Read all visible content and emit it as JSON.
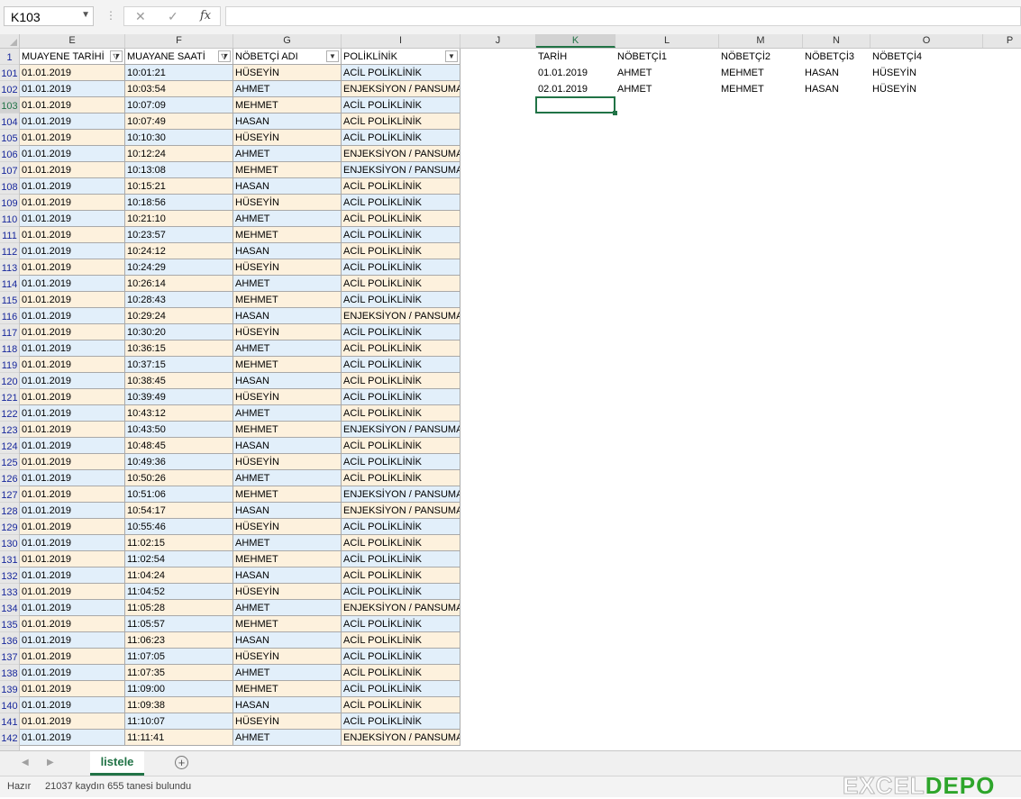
{
  "formula_bar": {
    "name_box": "K103",
    "cancel_icon": "✕",
    "enter_icon": "✓",
    "fx_label": "fx",
    "formula": ""
  },
  "columns": [
    "E",
    "F",
    "G",
    "I",
    "J",
    "K",
    "L",
    "M",
    "N",
    "O",
    "P"
  ],
  "selected_column": "K",
  "table": {
    "headers": [
      "MUAYENE TARİHİ",
      "MUAYANE SAATİ",
      "NÖBETÇİ ADI",
      "POLİKLİNİK"
    ],
    "header_row_number": "1",
    "filtered_columns": [
      0,
      1
    ],
    "rows": [
      {
        "n": "101",
        "date": "01.01.2019",
        "time": "10:01:21",
        "name": "HÜSEYİN",
        "clinic": "ACİL POLİKLİNİK"
      },
      {
        "n": "102",
        "date": "01.01.2019",
        "time": "10:03:54",
        "name": "AHMET",
        "clinic": "ENJEKSİYON / PANSUMAN"
      },
      {
        "n": "103",
        "date": "01.01.2019",
        "time": "10:07:09",
        "name": "MEHMET",
        "clinic": "ACİL POLİKLİNİK"
      },
      {
        "n": "104",
        "date": "01.01.2019",
        "time": "10:07:49",
        "name": "HASAN",
        "clinic": "ACİL POLİKLİNİK"
      },
      {
        "n": "105",
        "date": "01.01.2019",
        "time": "10:10:30",
        "name": "HÜSEYİN",
        "clinic": "ACİL POLİKLİNİK"
      },
      {
        "n": "106",
        "date": "01.01.2019",
        "time": "10:12:24",
        "name": "AHMET",
        "clinic": "ENJEKSİYON / PANSUMAN"
      },
      {
        "n": "107",
        "date": "01.01.2019",
        "time": "10:13:08",
        "name": "MEHMET",
        "clinic": "ENJEKSİYON / PANSUMAN"
      },
      {
        "n": "108",
        "date": "01.01.2019",
        "time": "10:15:21",
        "name": "HASAN",
        "clinic": "ACİL POLİKLİNİK"
      },
      {
        "n": "109",
        "date": "01.01.2019",
        "time": "10:18:56",
        "name": "HÜSEYİN",
        "clinic": "ACİL POLİKLİNİK"
      },
      {
        "n": "110",
        "date": "01.01.2019",
        "time": "10:21:10",
        "name": "AHMET",
        "clinic": "ACİL POLİKLİNİK"
      },
      {
        "n": "111",
        "date": "01.01.2019",
        "time": "10:23:57",
        "name": "MEHMET",
        "clinic": "ACİL POLİKLİNİK"
      },
      {
        "n": "112",
        "date": "01.01.2019",
        "time": "10:24:12",
        "name": "HASAN",
        "clinic": "ACİL POLİKLİNİK"
      },
      {
        "n": "113",
        "date": "01.01.2019",
        "time": "10:24:29",
        "name": "HÜSEYİN",
        "clinic": "ACİL POLİKLİNİK"
      },
      {
        "n": "114",
        "date": "01.01.2019",
        "time": "10:26:14",
        "name": "AHMET",
        "clinic": "ACİL POLİKLİNİK"
      },
      {
        "n": "115",
        "date": "01.01.2019",
        "time": "10:28:43",
        "name": "MEHMET",
        "clinic": "ACİL POLİKLİNİK"
      },
      {
        "n": "116",
        "date": "01.01.2019",
        "time": "10:29:24",
        "name": "HASAN",
        "clinic": "ENJEKSİYON / PANSUMAN"
      },
      {
        "n": "117",
        "date": "01.01.2019",
        "time": "10:30:20",
        "name": "HÜSEYİN",
        "clinic": "ACİL POLİKLİNİK"
      },
      {
        "n": "118",
        "date": "01.01.2019",
        "time": "10:36:15",
        "name": "AHMET",
        "clinic": "ACİL POLİKLİNİK"
      },
      {
        "n": "119",
        "date": "01.01.2019",
        "time": "10:37:15",
        "name": "MEHMET",
        "clinic": "ACİL POLİKLİNİK"
      },
      {
        "n": "120",
        "date": "01.01.2019",
        "time": "10:38:45",
        "name": "HASAN",
        "clinic": "ACİL POLİKLİNİK"
      },
      {
        "n": "121",
        "date": "01.01.2019",
        "time": "10:39:49",
        "name": "HÜSEYİN",
        "clinic": "ACİL POLİKLİNİK"
      },
      {
        "n": "122",
        "date": "01.01.2019",
        "time": "10:43:12",
        "name": "AHMET",
        "clinic": "ACİL POLİKLİNİK"
      },
      {
        "n": "123",
        "date": "01.01.2019",
        "time": "10:43:50",
        "name": "MEHMET",
        "clinic": "ENJEKSİYON / PANSUMAN"
      },
      {
        "n": "124",
        "date": "01.01.2019",
        "time": "10:48:45",
        "name": "HASAN",
        "clinic": "ACİL POLİKLİNİK"
      },
      {
        "n": "125",
        "date": "01.01.2019",
        "time": "10:49:36",
        "name": "HÜSEYİN",
        "clinic": "ACİL POLİKLİNİK"
      },
      {
        "n": "126",
        "date": "01.01.2019",
        "time": "10:50:26",
        "name": "AHMET",
        "clinic": "ACİL POLİKLİNİK"
      },
      {
        "n": "127",
        "date": "01.01.2019",
        "time": "10:51:06",
        "name": "MEHMET",
        "clinic": "ENJEKSİYON / PANSUMAN"
      },
      {
        "n": "128",
        "date": "01.01.2019",
        "time": "10:54:17",
        "name": "HASAN",
        "clinic": "ENJEKSİYON / PANSUMAN"
      },
      {
        "n": "129",
        "date": "01.01.2019",
        "time": "10:55:46",
        "name": "HÜSEYİN",
        "clinic": "ACİL POLİKLİNİK"
      },
      {
        "n": "130",
        "date": "01.01.2019",
        "time": "11:02:15",
        "name": "AHMET",
        "clinic": "ACİL POLİKLİNİK"
      },
      {
        "n": "131",
        "date": "01.01.2019",
        "time": "11:02:54",
        "name": "MEHMET",
        "clinic": "ACİL POLİKLİNİK"
      },
      {
        "n": "132",
        "date": "01.01.2019",
        "time": "11:04:24",
        "name": "HASAN",
        "clinic": "ACİL POLİKLİNİK"
      },
      {
        "n": "133",
        "date": "01.01.2019",
        "time": "11:04:52",
        "name": "HÜSEYİN",
        "clinic": "ACİL POLİKLİNİK"
      },
      {
        "n": "134",
        "date": "01.01.2019",
        "time": "11:05:28",
        "name": "AHMET",
        "clinic": "ENJEKSİYON / PANSUMAN"
      },
      {
        "n": "135",
        "date": "01.01.2019",
        "time": "11:05:57",
        "name": "MEHMET",
        "clinic": "ACİL POLİKLİNİK"
      },
      {
        "n": "136",
        "date": "01.01.2019",
        "time": "11:06:23",
        "name": "HASAN",
        "clinic": "ACİL POLİKLİNİK"
      },
      {
        "n": "137",
        "date": "01.01.2019",
        "time": "11:07:05",
        "name": "HÜSEYİN",
        "clinic": "ACİL POLİKLİNİK"
      },
      {
        "n": "138",
        "date": "01.01.2019",
        "time": "11:07:35",
        "name": "AHMET",
        "clinic": "ACİL POLİKLİNİK"
      },
      {
        "n": "139",
        "date": "01.01.2019",
        "time": "11:09:00",
        "name": "MEHMET",
        "clinic": "ACİL POLİKLİNİK"
      },
      {
        "n": "140",
        "date": "01.01.2019",
        "time": "11:09:38",
        "name": "HASAN",
        "clinic": "ACİL POLİKLİNİK"
      },
      {
        "n": "141",
        "date": "01.01.2019",
        "time": "11:10:07",
        "name": "HÜSEYİN",
        "clinic": "ACİL POLİKLİNİK"
      },
      {
        "n": "142",
        "date": "01.01.2019",
        "time": "11:11:41",
        "name": "AHMET",
        "clinic": "ENJEKSİYON / PANSUMAN"
      }
    ]
  },
  "duty_table": {
    "headers": [
      "TARİH",
      "NÖBETÇİ1",
      "NÖBETÇİ2",
      "NÖBETÇİ3",
      "NÖBETÇİ4"
    ],
    "rows": [
      [
        "01.01.2019",
        "AHMET",
        "MEHMET",
        "HASAN",
        "HÜSEYİN"
      ],
      [
        "02.01.2019",
        "AHMET",
        "MEHMET",
        "HASAN",
        "HÜSEYİN"
      ]
    ]
  },
  "sheet_tabs": [
    "listele"
  ],
  "status": {
    "ready": "Hazır",
    "message": "21037 kaydın 655 tanesi bulundu"
  },
  "logo": {
    "part1": "EXCEL",
    "part2": "DEPO"
  },
  "colors": {
    "band_orange": "#fdf1dd",
    "band_blue": "#e2effa",
    "header_green": "#217346",
    "row_number_blue": "#17279c",
    "logo_green": "#2ea52b"
  }
}
